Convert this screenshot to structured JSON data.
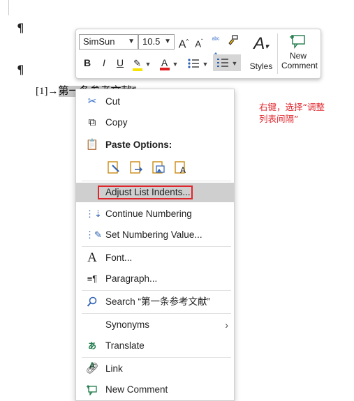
{
  "document": {
    "pilcrow": "¶",
    "list_prefix": "[1]→",
    "selected_text": "第一条参考文献",
    "end_mark": "¶"
  },
  "mini_toolbar": {
    "font_name": "SimSun",
    "font_size": "10.5",
    "styles_label": "Styles",
    "new_comment_label": "New Comment",
    "bold": "B",
    "italic": "I",
    "underline": "U",
    "grow_font": "A",
    "shrink_font": "A",
    "highlight_color": "#f6e300",
    "font_color": "#e02020"
  },
  "context_menu": {
    "cut": "Cut",
    "copy": "Copy",
    "paste_options": "Paste Options:",
    "adjust_list_indents": "Adjust List Indents...",
    "continue_numbering": "Continue Numbering",
    "set_numbering_value": "Set Numbering Value...",
    "font": "Font...",
    "paragraph": "Paragraph...",
    "search": "Search “第一条参考文献”",
    "synonyms": "Synonyms",
    "translate": "Translate",
    "link": "Link",
    "new_comment": "New Comment"
  },
  "annotation": {
    "text": "右键，选择“调整列表间隔”",
    "color": "#e0262d"
  }
}
